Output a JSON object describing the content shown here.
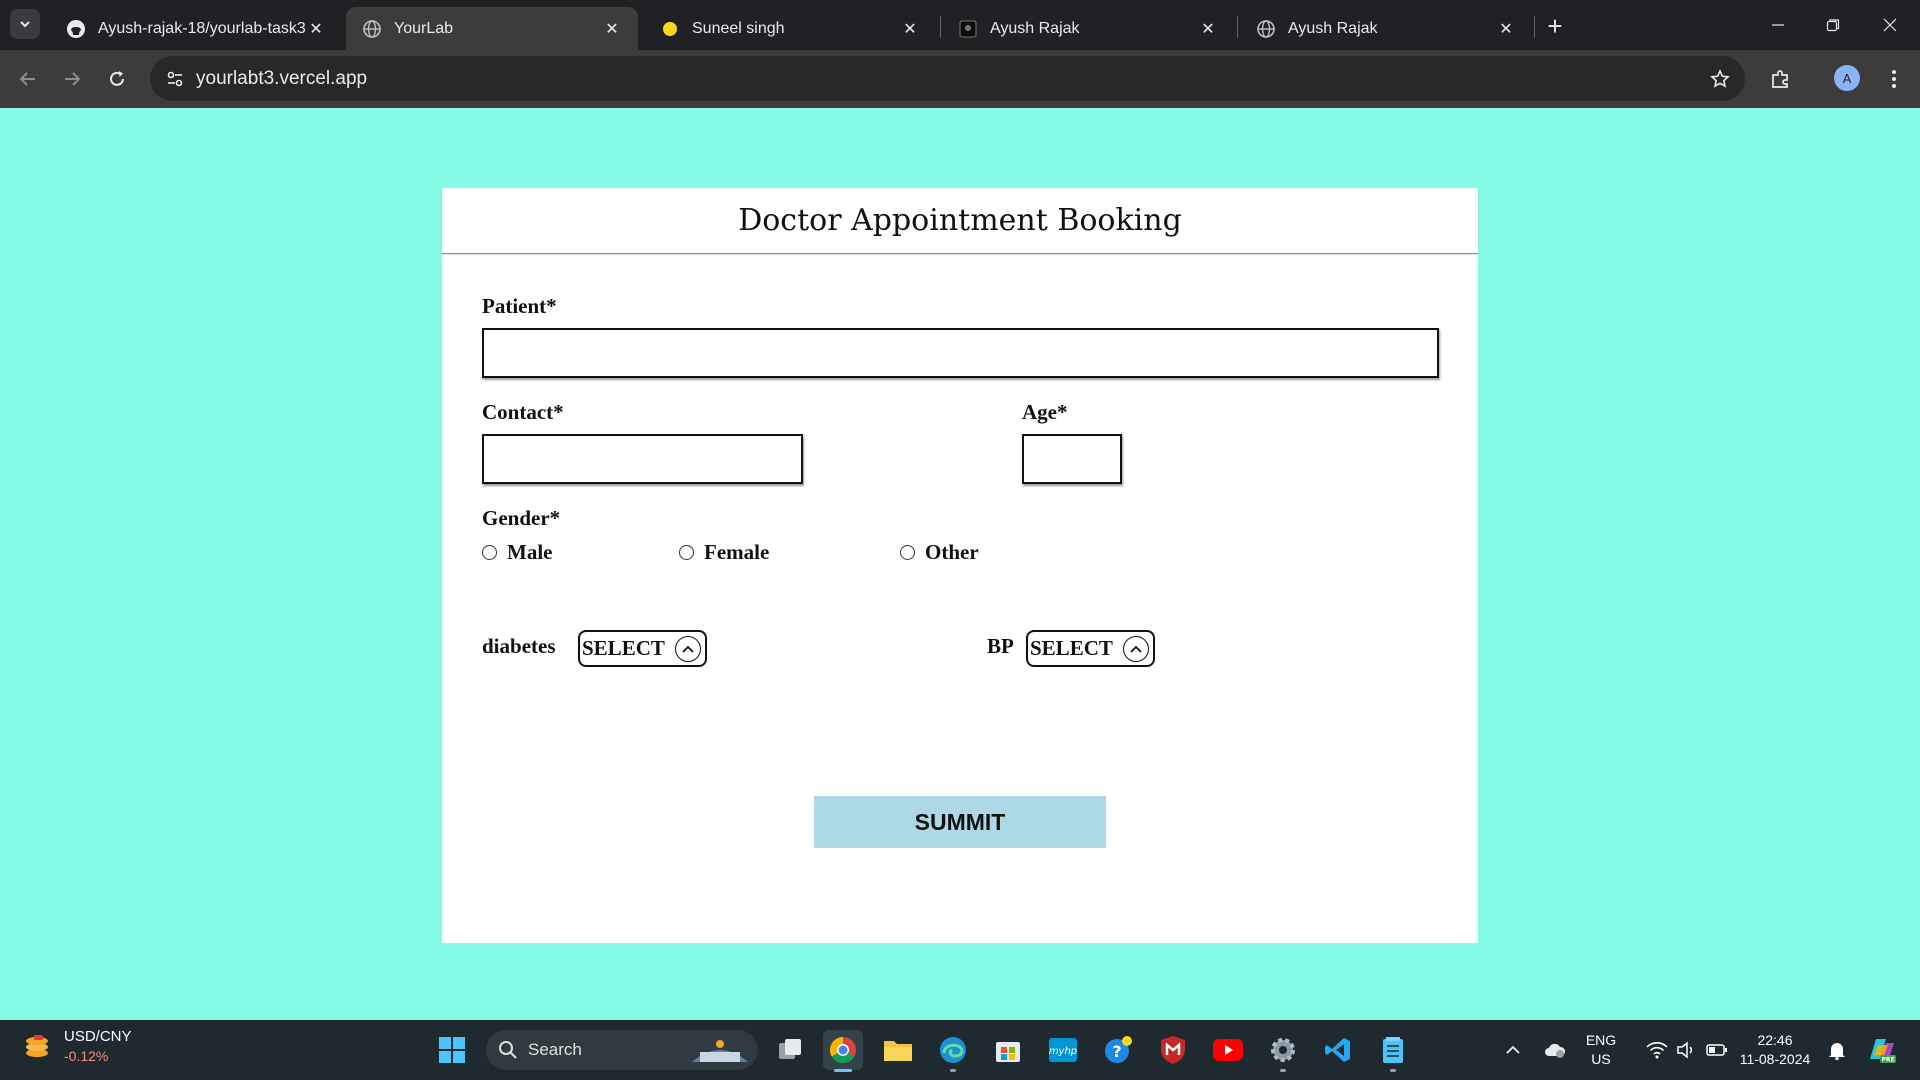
{
  "browser": {
    "tabs": [
      {
        "title": "Ayush-rajak-18/yourlab-task3",
        "icon": "github-icon"
      },
      {
        "title": "YourLab",
        "icon": "globe-icon",
        "active": true
      },
      {
        "title": "Suneel singh",
        "icon": "yellow-dot-icon"
      },
      {
        "title": "Ayush Rajak",
        "icon": "dark-favicon-icon"
      },
      {
        "title": "Ayush Rajak",
        "icon": "globe-icon"
      }
    ],
    "url": "yourlabt3.vercel.app",
    "profile_initial": "A"
  },
  "form": {
    "title": "Doctor Appointment Booking",
    "patient_label": "Patient*",
    "contact_label": "Contact*",
    "age_label": "Age*",
    "gender_label": "Gender*",
    "gender_options": [
      "Male",
      "Female",
      "Other"
    ],
    "diabetes_label": "diabetes",
    "bp_label": "BP",
    "select_text": "SELECT",
    "submit_label": "SUMMIT"
  },
  "colors": {
    "page_background": "#86fce8",
    "submit_background": "#add8e6",
    "card_background": "#ffffff"
  },
  "taskbar": {
    "widget_title": "USD/CNY",
    "widget_value": "-0.12%",
    "search_placeholder": "Search",
    "lang_top": "ENG",
    "lang_bottom": "US",
    "time": "22:46",
    "date": "11-08-2024"
  }
}
